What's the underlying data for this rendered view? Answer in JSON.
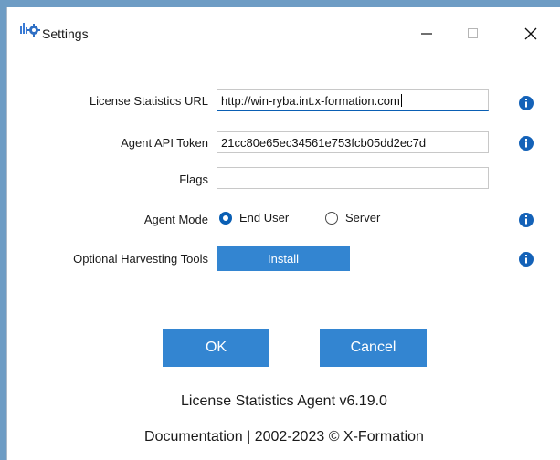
{
  "window": {
    "title": "Settings",
    "minimize_icon": "minimize-icon",
    "maximize_icon": "maximize-icon",
    "close_icon": "close-icon"
  },
  "form": {
    "license_url": {
      "label": "License Statistics URL",
      "value": "http://win-ryba.int.x-formation.com",
      "focused": true
    },
    "agent_token": {
      "label": "Agent API Token",
      "value": "21cc80e65ec34561e753fcb05dd2ec7d"
    },
    "flags": {
      "label": "Flags",
      "value": ""
    },
    "agent_mode": {
      "label": "Agent Mode",
      "options": [
        "End User",
        "Server"
      ],
      "selected": "End User"
    },
    "harvesting": {
      "label": "Optional Harvesting Tools",
      "button": "Install"
    }
  },
  "actions": {
    "ok": "OK",
    "cancel": "Cancel"
  },
  "footer": {
    "version": "License Statistics Agent v6.19.0",
    "documentation": "Documentation",
    "separator": "|",
    "copyright": "2002-2023 © X-Formation"
  },
  "colors": {
    "accent": "#3385d1",
    "info": "#1462b8",
    "frame": "#6e9cc4"
  }
}
